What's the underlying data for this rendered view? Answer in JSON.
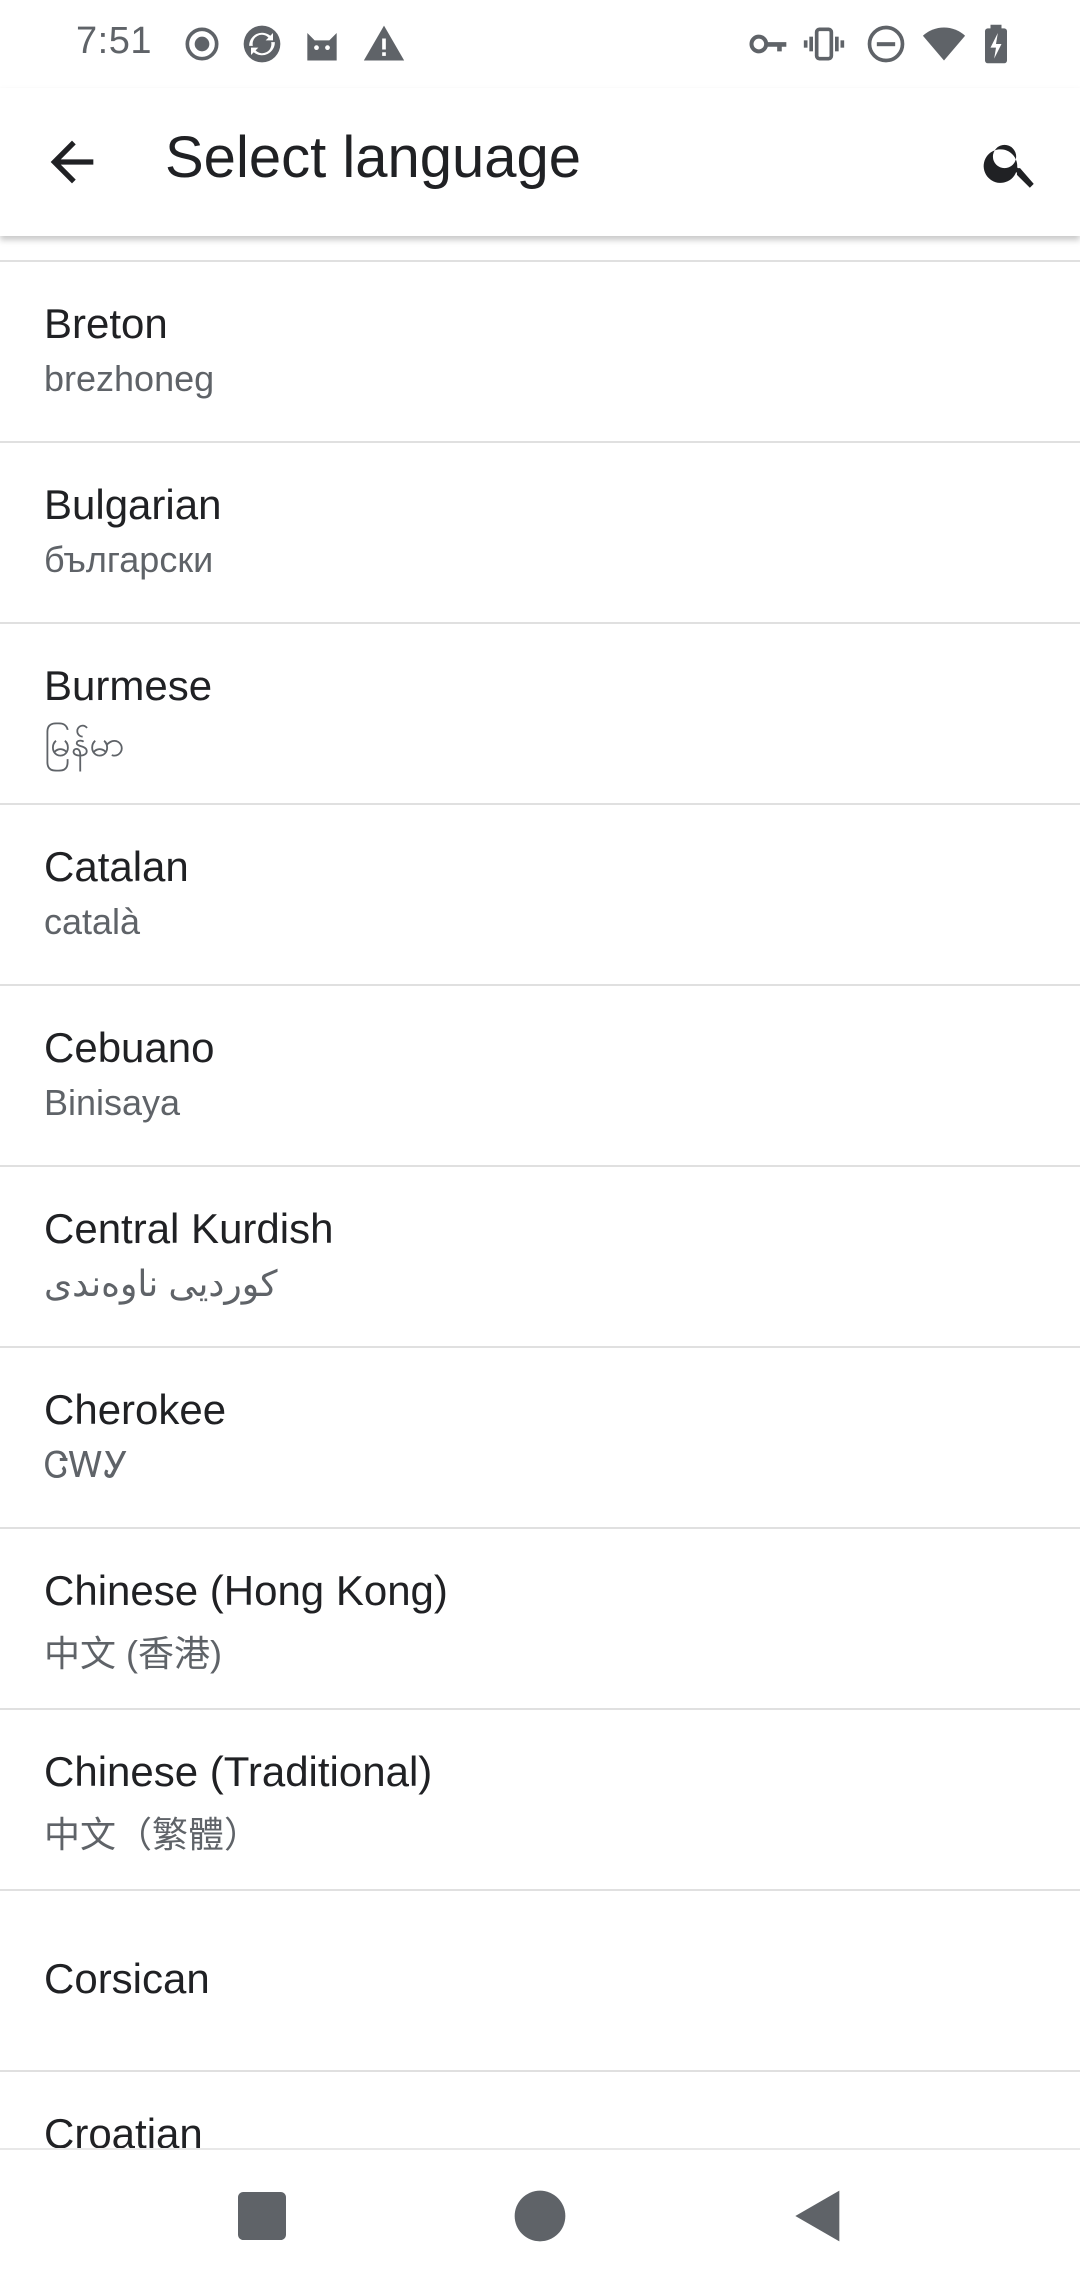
{
  "status_bar": {
    "time": "7:51",
    "left_icons": [
      "record-icon",
      "sync-app-icon",
      "cat-app-icon",
      "warning-icon"
    ],
    "right_icons": [
      "vpn-key-icon",
      "vibrate-icon",
      "do-not-disturb-icon",
      "wifi-icon",
      "battery-charging-icon"
    ]
  },
  "app_bar": {
    "title": "Select language",
    "back_icon": "arrow-back-icon",
    "search_icon": "search-icon"
  },
  "languages": [
    {
      "name": "Breton",
      "native": "brezhoneg"
    },
    {
      "name": "Bulgarian",
      "native": "български"
    },
    {
      "name": "Burmese",
      "native": "မြန်မာ"
    },
    {
      "name": "Catalan",
      "native": "català"
    },
    {
      "name": "Cebuano",
      "native": "Binisaya"
    },
    {
      "name": "Central Kurdish",
      "native": "کوردیی ناوەندی"
    },
    {
      "name": "Cherokee",
      "native": "ᏣᎳᎩ"
    },
    {
      "name": "Chinese (Hong Kong)",
      "native": "中文 (香港)"
    },
    {
      "name": "Chinese (Traditional)",
      "native": "中文（繁體）"
    },
    {
      "name": "Corsican",
      "native": ""
    },
    {
      "name": "Croatian",
      "native": ""
    }
  ],
  "nav_bar": {
    "recents_icon": "recents-square-icon",
    "home_icon": "home-circle-icon",
    "back_icon": "back-triangle-icon"
  },
  "colors": {
    "primary_text": "#202124",
    "secondary_text": "#5f6368",
    "divider": "#e0e0e0",
    "icon": "#5f6368"
  }
}
